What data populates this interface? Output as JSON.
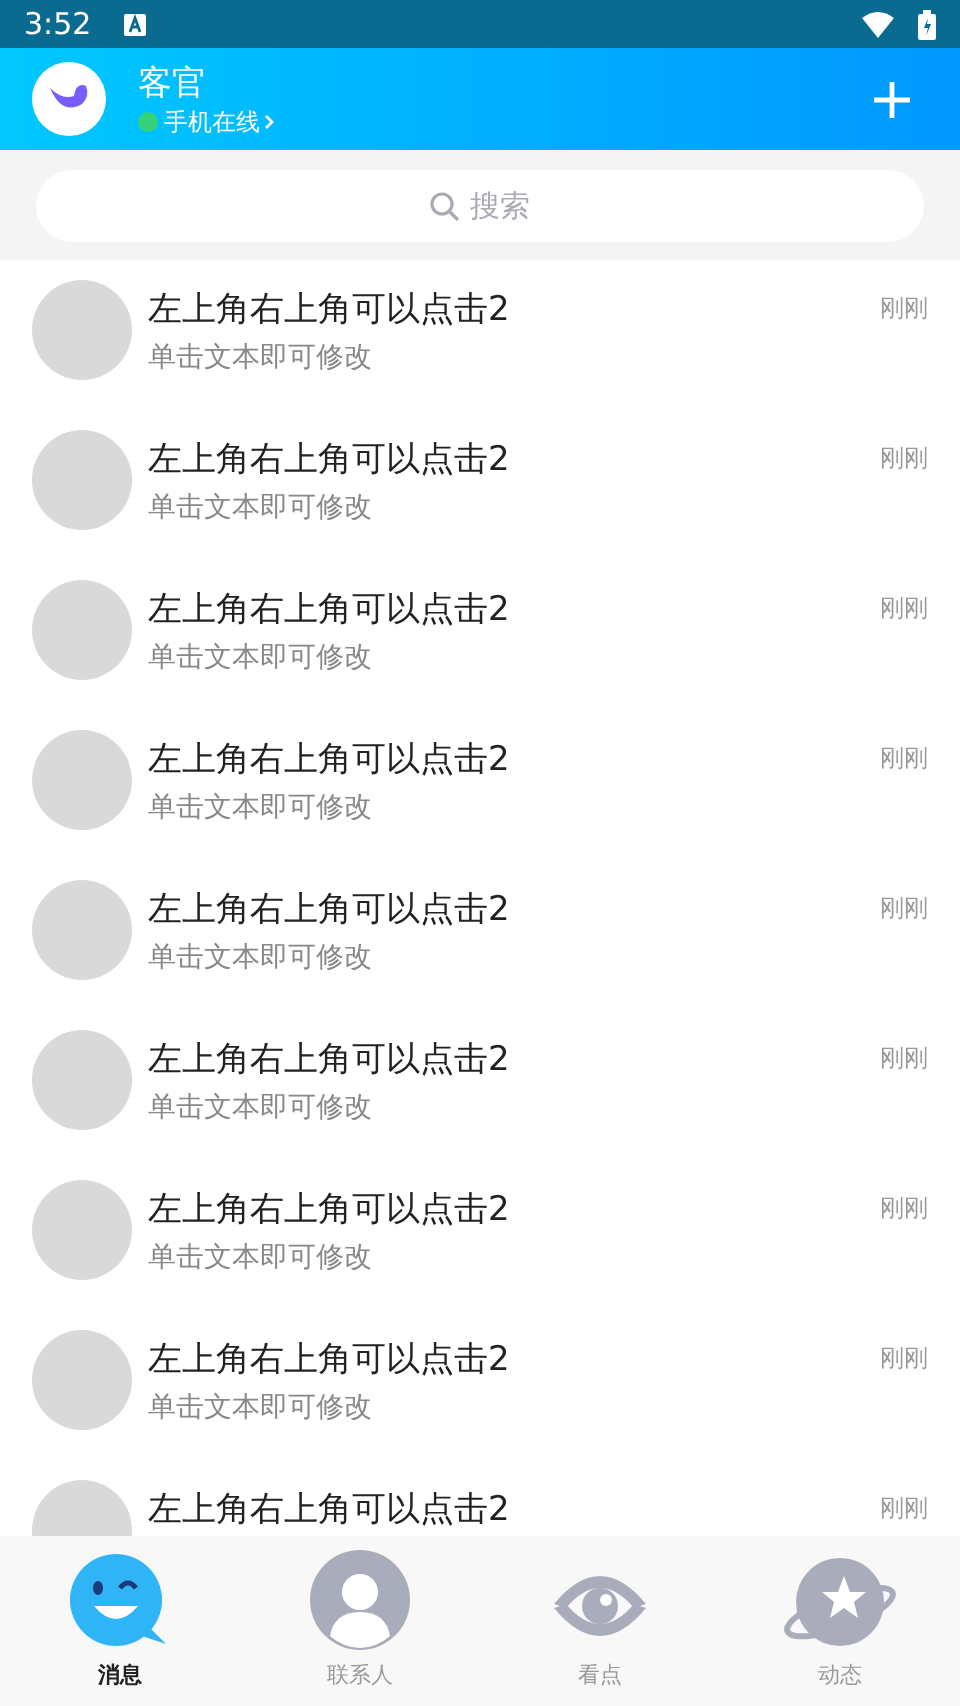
{
  "status_bar": {
    "time": "3:52"
  },
  "header": {
    "name": "客官",
    "status": "手机在线",
    "online": true
  },
  "search": {
    "placeholder": "搜索"
  },
  "conversations": [
    {
      "title": "左上角右上角可以点击2",
      "subtitle": "单击文本即可修改",
      "time": "刚刚"
    },
    {
      "title": "左上角右上角可以点击2",
      "subtitle": "单击文本即可修改",
      "time": "刚刚"
    },
    {
      "title": "左上角右上角可以点击2",
      "subtitle": "单击文本即可修改",
      "time": "刚刚"
    },
    {
      "title": "左上角右上角可以点击2",
      "subtitle": "单击文本即可修改",
      "time": "刚刚"
    },
    {
      "title": "左上角右上角可以点击2",
      "subtitle": "单击文本即可修改",
      "time": "刚刚"
    },
    {
      "title": "左上角右上角可以点击2",
      "subtitle": "单击文本即可修改",
      "time": "刚刚"
    },
    {
      "title": "左上角右上角可以点击2",
      "subtitle": "单击文本即可修改",
      "time": "刚刚"
    },
    {
      "title": "左上角右上角可以点击2",
      "subtitle": "单击文本即可修改",
      "time": "刚刚"
    },
    {
      "title": "左上角右上角可以点击2",
      "time": "刚刚"
    }
  ],
  "tabs": [
    {
      "label": "消息",
      "selected": true
    },
    {
      "label": "联系人",
      "selected": false
    },
    {
      "label": "看点",
      "selected": false
    },
    {
      "label": "动态",
      "selected": false
    }
  ]
}
